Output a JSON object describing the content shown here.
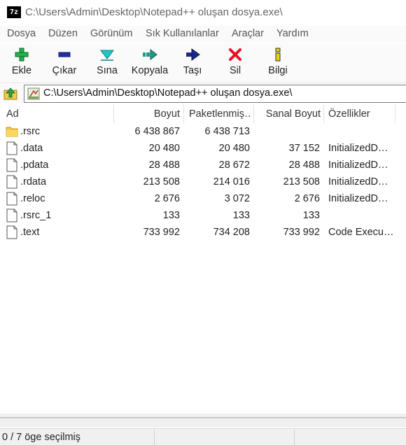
{
  "window": {
    "title": "C:\\Users\\Admin\\Desktop\\Notepad++ oluşan dosya.exe\\",
    "app_icon_text": "7z"
  },
  "menu": [
    "Dosya",
    "Düzen",
    "Görünüm",
    "Sık Kullanılanlar",
    "Araçlar",
    "Yardım"
  ],
  "toolbar": [
    {
      "label": "Ekle",
      "icon": "add-icon",
      "color": "#22b14c"
    },
    {
      "label": "Çıkar",
      "icon": "extract-icon",
      "color": "#1f2fa8"
    },
    {
      "label": "Sına",
      "icon": "test-icon",
      "color": "#1cc8c8"
    },
    {
      "label": "Kopyala",
      "icon": "copy-icon",
      "color": "#1e9a8a"
    },
    {
      "label": "Taşı",
      "icon": "move-icon",
      "color": "#1d2a8a"
    },
    {
      "label": "Sil",
      "icon": "delete-icon",
      "color": "#e81123"
    },
    {
      "label": "Bilgi",
      "icon": "info-icon",
      "color": "#e8d000"
    }
  ],
  "address": {
    "path": "C:\\Users\\Admin\\Desktop\\Notepad++ oluşan dosya.exe\\"
  },
  "columns": [
    "Ad",
    "Boyut",
    "Paketlenmiş…",
    "Sanal Boyut",
    "Özellikler"
  ],
  "rows": [
    {
      "icon": "folder-icon",
      "name": ".rsrc",
      "size": "6 438 867",
      "packed": "6 438 713",
      "virtual": "",
      "attrs": ""
    },
    {
      "icon": "file-icon",
      "name": ".data",
      "size": "20 480",
      "packed": "20 480",
      "virtual": "37 152",
      "attrs": "InitializedD…"
    },
    {
      "icon": "file-icon",
      "name": ".pdata",
      "size": "28 488",
      "packed": "28 672",
      "virtual": "28 488",
      "attrs": "InitializedD…"
    },
    {
      "icon": "file-icon",
      "name": ".rdata",
      "size": "213 508",
      "packed": "214 016",
      "virtual": "213 508",
      "attrs": "InitializedD…"
    },
    {
      "icon": "file-icon",
      "name": ".reloc",
      "size": "2 676",
      "packed": "3 072",
      "virtual": "2 676",
      "attrs": "InitializedD…"
    },
    {
      "icon": "file-icon",
      "name": ".rsrc_1",
      "size": "133",
      "packed": "133",
      "virtual": "133",
      "attrs": ""
    },
    {
      "icon": "file-icon",
      "name": ".text",
      "size": "733 992",
      "packed": "734 208",
      "virtual": "733 992",
      "attrs": "Code Execu…"
    }
  ],
  "status": {
    "selection": "0 / 7 öge seçilmiş"
  }
}
